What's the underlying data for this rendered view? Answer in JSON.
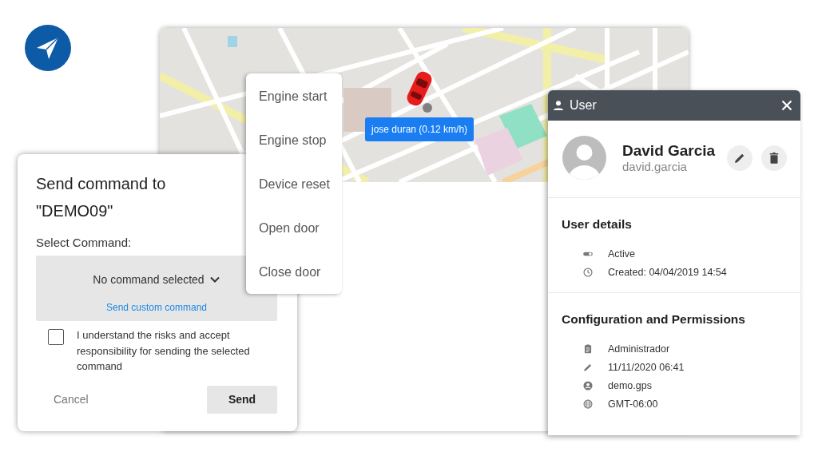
{
  "map_window": {
    "marker_label": "jose duran (0.12 km/h)"
  },
  "command_menu": {
    "items": [
      {
        "label": "Engine start"
      },
      {
        "label": "Engine stop"
      },
      {
        "label": "Device reset"
      },
      {
        "label": "Open door"
      },
      {
        "label": "Close door"
      }
    ]
  },
  "send_command_dialog": {
    "title": "Send command to \"DEMO09\"",
    "select_label": "Select Command:",
    "select": {
      "value": "No command selected"
    },
    "custom_command_link": "Send custom command",
    "consent": {
      "checked": false,
      "text": "I understand the risks and accept responsibility for sending the selected command"
    },
    "buttons": [
      {
        "label": "Cancel",
        "kind": "text"
      },
      {
        "label": "Send",
        "kind": "filled"
      }
    ]
  },
  "user_panel": {
    "title": "User",
    "name": "David Garcia",
    "username": "david.garcia",
    "sections": [
      {
        "heading": "User details",
        "rows": [
          {
            "kind": "status",
            "text": "Active"
          },
          {
            "kind": "created",
            "text": "Created: 04/04/2019 14:54"
          }
        ]
      },
      {
        "heading": "Configuration and Permissions",
        "rows": [
          {
            "kind": "role",
            "text": "Administrador"
          },
          {
            "kind": "modified",
            "text": "11/11/2020 06:41"
          },
          {
            "kind": "account",
            "text": "demo.gps"
          },
          {
            "kind": "timezone",
            "text": "GMT-06:00"
          }
        ]
      }
    ]
  }
}
